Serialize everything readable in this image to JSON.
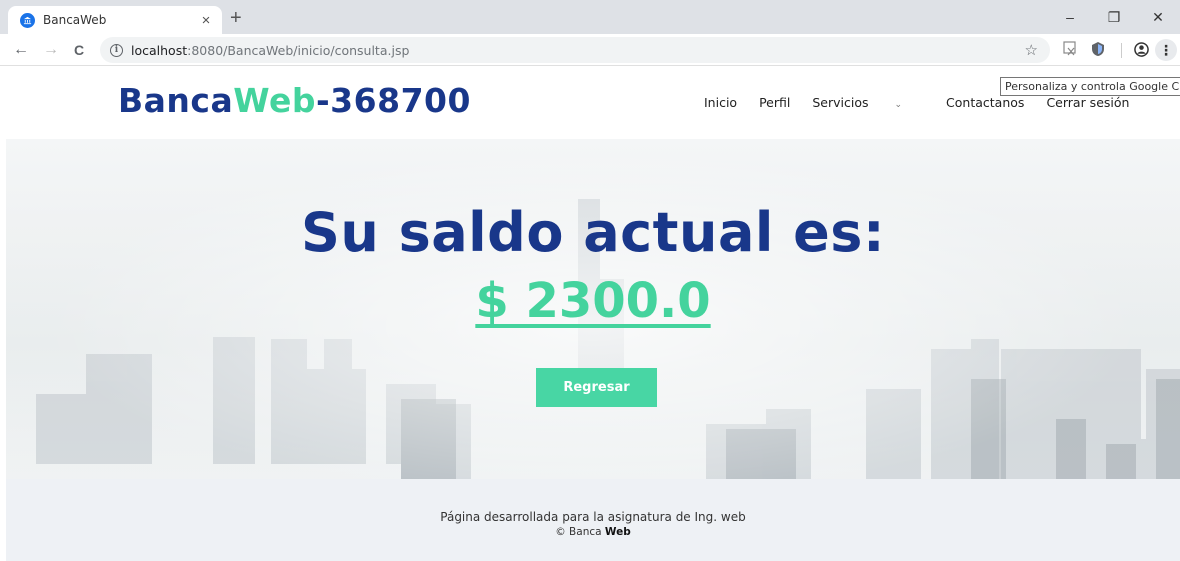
{
  "browser": {
    "tab_title": "BancaWeb",
    "tab_close": "×",
    "new_tab": "+",
    "url_host": "localhost",
    "url_path": ":8080/BancaWeb/inicio/consulta.jsp",
    "window_controls": {
      "minimize": "–",
      "restore": "❐",
      "close": "✕"
    },
    "nav": {
      "back": "←",
      "forward": "→",
      "reload": "C"
    },
    "star": "☆",
    "menu": "⋮",
    "info": "i",
    "tooltip": "Personaliza y controla Google Chrome"
  },
  "header": {
    "logo_part1": "Banca",
    "logo_part2": "Web",
    "logo_part3": "-368700",
    "nav": [
      {
        "label": "Inicio"
      },
      {
        "label": "Perfil"
      },
      {
        "label": "Servicios"
      },
      {
        "label": "Contactanos"
      },
      {
        "label": "Cerrar sesión"
      }
    ],
    "services_chevron": "⌄"
  },
  "hero": {
    "headline": "Su saldo actual es:",
    "balance": "$ 2300.0",
    "back_button": "Regresar"
  },
  "footer": {
    "line1": "Página desarrollada para la asignatura de Ing. web",
    "copyright_prefix": "© Banca ",
    "copyright_bold": "Web"
  },
  "colors": {
    "brand_navy": "#19378a",
    "brand_green": "#44d39d",
    "button_bg": "#48d6a4",
    "footer_bg": "#eef1f5"
  }
}
